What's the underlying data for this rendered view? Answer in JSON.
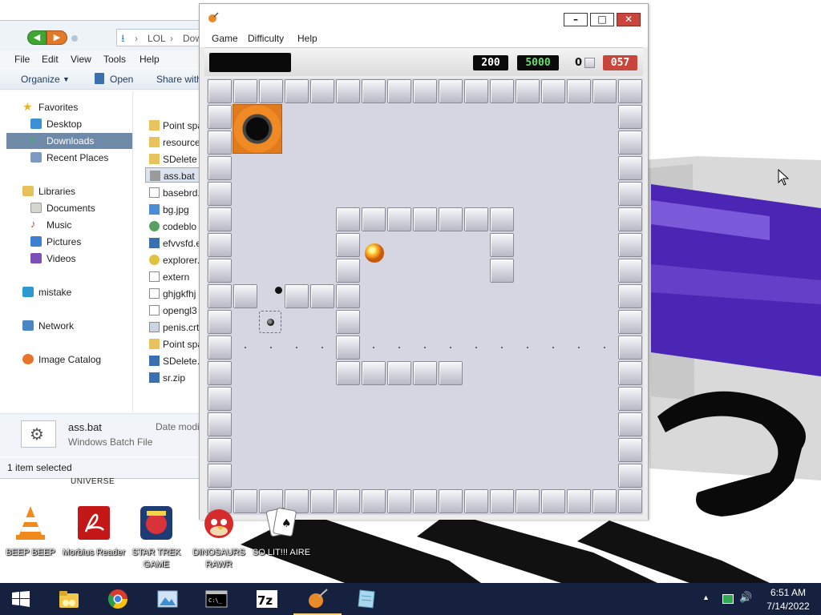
{
  "explorer": {
    "breadcrumb": [
      "LOL",
      "Dow"
    ],
    "menu": [
      "File",
      "Edit",
      "View",
      "Tools",
      "Help"
    ],
    "commands": {
      "organize": "Organize",
      "open": "Open",
      "share": "Share with"
    },
    "nav": {
      "favorites": "Favorites",
      "desktop": "Desktop",
      "downloads": "Downloads",
      "recent": "Recent Places",
      "libraries": "Libraries",
      "documents": "Documents",
      "music": "Music",
      "pictures": "Pictures",
      "videos": "Videos",
      "mistake": "mistake",
      "network": "Network",
      "image_catalog": "Image Catalog"
    },
    "files": [
      "Point spa",
      "resource",
      "SDelete",
      "ass.bat",
      "basebrd.",
      "bg.jpg",
      "codeblo",
      "efvvsfd.e",
      "explorer.",
      "extern",
      "ghjgkfhj",
      "opengl3",
      "penis.crt",
      "Point spa",
      "SDelete.z",
      "sr.zip"
    ],
    "selected_file": "ass.bat",
    "details": {
      "name": "ass.bat",
      "type": "Windows Batch File",
      "date_label": "Date modi"
    },
    "status": "1 item selected"
  },
  "game": {
    "menu": [
      "Game",
      "Difficulty",
      "Help"
    ],
    "hud": {
      "score": "200",
      "target": "5000",
      "count": "0",
      "time": "057"
    },
    "colors": {
      "hud_time_bg": "#c9463d",
      "target_text": "#6fdc6f",
      "board_bg": "#d6d5e2"
    }
  },
  "desktop": {
    "top_label": "UNIVERSE",
    "icons": [
      {
        "label": "BEEP BEEP",
        "icon": "vlc-cone-icon"
      },
      {
        "label": "Morbius Reader",
        "icon": "pdf-reader-icon"
      },
      {
        "label": "STAR TREK GAME",
        "icon": "star-wars-angry-birds-icon"
      },
      {
        "label": "DINOSAURS RAWR",
        "icon": "angry-birds-icon"
      },
      {
        "label": "SO LIT!!! AIRE",
        "icon": "solitaire-cards-icon"
      }
    ]
  },
  "taskbar": {
    "items": [
      "start-icon",
      "file-explorer-icon",
      "chrome-icon",
      "image-viewer-icon",
      "terminal-icon",
      "7zip-icon",
      "ball-game-icon",
      "notepad-icon"
    ],
    "time": "6:51 AM",
    "date": "7/14/2022"
  }
}
